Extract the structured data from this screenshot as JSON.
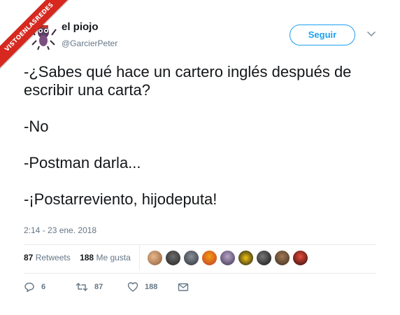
{
  "watermark": {
    "text": "VISTOENLASREDES"
  },
  "user": {
    "display_name": "el piojo",
    "handle": "@GarcierPeter"
  },
  "follow_label": "Seguir",
  "tweet": {
    "lines": [
      "-¿Sabes qué hace un cartero inglés después de escribir una carta?",
      "-No",
      "-Postman darla...",
      "-¡Postarreviento, hijodeputa!"
    ],
    "timestamp": "2:14 - 23 ene. 2018"
  },
  "stats": {
    "retweets_count": "87",
    "retweets_label": "Retweets",
    "likes_count": "188",
    "likes_label": "Me gusta"
  },
  "actions": {
    "reply_count": "6",
    "retweet_count": "87",
    "like_count": "188"
  },
  "colors": {
    "accent": "#1da1f2",
    "muted": "#657786",
    "watermark": "#d6281f"
  }
}
